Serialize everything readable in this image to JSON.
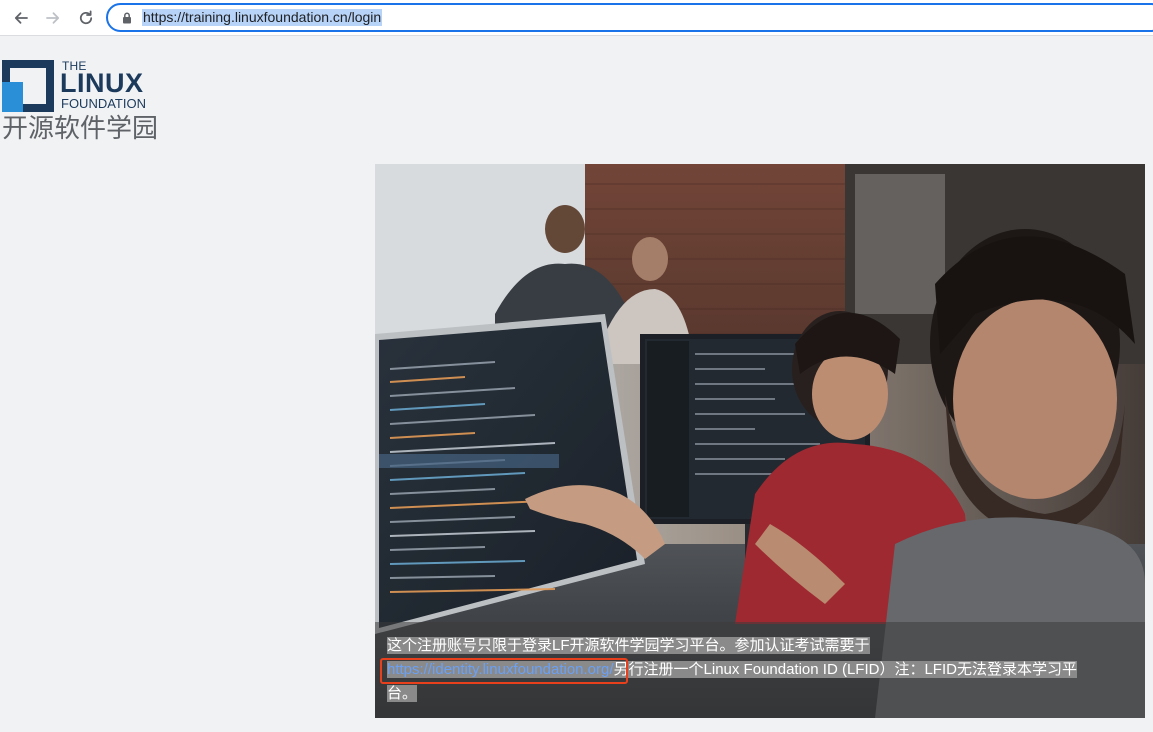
{
  "browser": {
    "url": "https://training.linuxfoundation.cn/login"
  },
  "logo": {
    "the": "THE",
    "linux": "LINUX",
    "foundation": "FOUNDATION",
    "cn_name": "开源软件学园"
  },
  "hero": {
    "caption_line1": "这个注册账号只限于登录LF开源软件学园学习平台。参加认证考试需要于",
    "link_text": "https://identity.linuxfoundation.org/",
    "caption_line2_rest": "另行注册一个Linux Foundation ID (LFID）注：LFID无法登录本学习平",
    "caption_line3": "台。"
  },
  "colors": {
    "accent": "#1a73e8",
    "logo_navy": "#1b3a5c",
    "logo_blue": "#2a8fd6",
    "highlight_box": "#e8401c",
    "link": "#6aa0f5"
  }
}
